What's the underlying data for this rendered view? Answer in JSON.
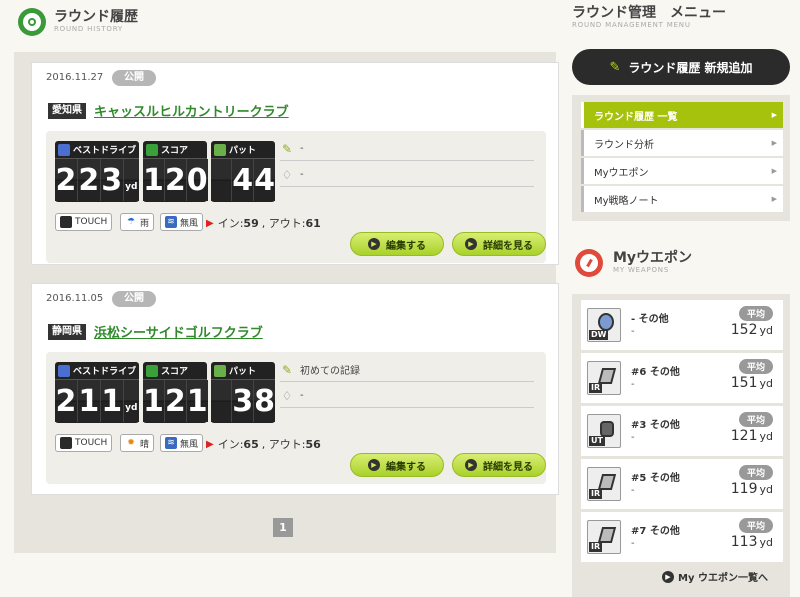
{
  "history": {
    "title": "ラウンド履歴",
    "subtitle": "ROUND HISTORY"
  },
  "rounds": [
    {
      "date": "2016.11.27",
      "status": "公開",
      "prefecture": "愛知県",
      "club": "キャッスルヒルカントリークラブ",
      "best_drive_label": "ベストドライブ",
      "best_drive_digits": [
        "2",
        "2",
        "3"
      ],
      "best_drive_unit": "yd",
      "score_label": "スコア",
      "score_digits": [
        "1",
        "2",
        "0"
      ],
      "putt_label": "パット",
      "putt_digits": [
        "",
        "4",
        "4"
      ],
      "memo": "-",
      "note": "-",
      "device": "TOUCH",
      "weather": "雨",
      "wind": "無風",
      "in_label": "イン:",
      "in_value": "59",
      "out_label": ", アウト:",
      "out_value": "61",
      "edit_label": "編集する",
      "detail_label": "詳細を見る"
    },
    {
      "date": "2016.11.05",
      "status": "公開",
      "prefecture": "静岡県",
      "club": "浜松シーサイドゴルフクラブ",
      "best_drive_label": "ベストドライブ",
      "best_drive_digits": [
        "2",
        "1",
        "1"
      ],
      "best_drive_unit": "yd",
      "score_label": "スコア",
      "score_digits": [
        "1",
        "2",
        "1"
      ],
      "putt_label": "パット",
      "putt_digits": [
        "",
        "3",
        "8"
      ],
      "memo": "初めての記録",
      "note": "-",
      "device": "TOUCH",
      "weather": "晴",
      "wind": "無風",
      "in_label": "イン:",
      "in_value": "65",
      "out_label": ", アウト:",
      "out_value": "56",
      "edit_label": "編集する",
      "detail_label": "詳細を見る"
    }
  ],
  "pagination": {
    "current": "1"
  },
  "management": {
    "title": "ラウンド管理　メニュー",
    "subtitle": "ROUND MANAGEMENT MENU",
    "add_button": "ラウンド履歴 新規追加",
    "menu": [
      {
        "label": "ラウンド履歴 一覧",
        "active": true
      },
      {
        "label": "ラウンド分析",
        "active": false
      },
      {
        "label": "Myウエポン",
        "active": false
      },
      {
        "label": "My戦略ノート",
        "active": false
      }
    ]
  },
  "weapons": {
    "title": "Myウエポン",
    "subtitle": "MY WEAPONS",
    "avg_label": "平均",
    "unit": "yd",
    "items": [
      {
        "name": "- その他",
        "sub": "-",
        "type": "DW",
        "distance": "152"
      },
      {
        "name": "#6 その他",
        "sub": "-",
        "type": "IR",
        "distance": "151"
      },
      {
        "name": "#3 その他",
        "sub": "-",
        "type": "UT",
        "distance": "121"
      },
      {
        "name": "#5 その他",
        "sub": "-",
        "type": "IR",
        "distance": "119"
      },
      {
        "name": "#7 その他",
        "sub": "-",
        "type": "IR",
        "distance": "113"
      }
    ],
    "link": "My ウエポン一覧へ"
  },
  "colors": {
    "accent_green": "#a7c20d",
    "club_link": "#2f8a2a",
    "history_icon": "#3a9a3a",
    "weapons_icon": "#e04a3a"
  }
}
